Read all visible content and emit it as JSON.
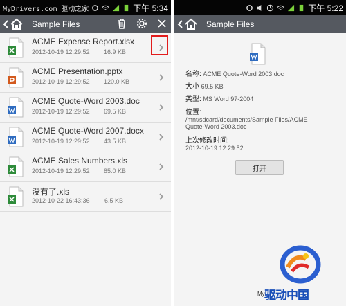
{
  "watermark_top": "MyDrivers.com 驱动之家",
  "left_status": {
    "time": "下午 5:34"
  },
  "right_status": {
    "time": "下午 5:22"
  },
  "left_appbar": {
    "title": "Sample Files"
  },
  "right_appbar": {
    "title": "Sample Files"
  },
  "files": [
    {
      "name": "ACME Expense Report.xlsx",
      "date": "2012-10-19 12:29:52",
      "size": "16.9 KB",
      "type": "xls"
    },
    {
      "name": "ACME Presentation.pptx",
      "date": "2012-10-19 12:29:52",
      "size": "120.0 KB",
      "type": "ppt"
    },
    {
      "name": "ACME Quote-Word 2003.doc",
      "date": "2012-10-19 12:29:52",
      "size": "69.5 KB",
      "type": "doc"
    },
    {
      "name": "ACME Quote-Word 2007.docx",
      "date": "2012-10-19 12:29:52",
      "size": "43.5 KB",
      "type": "doc"
    },
    {
      "name": "ACME Sales Numbers.xls",
      "date": "2012-10-19 12:29:52",
      "size": "85.0 KB",
      "type": "xls"
    },
    {
      "name": "没有了.xls",
      "date": "2012-10-22 16:43:36",
      "size": "6.5 KB",
      "type": "xls"
    }
  ],
  "detail": {
    "name_label": "名称:",
    "name_value": "ACME Quote-Word 2003.doc",
    "size_label": "大小",
    "size_value": "69.5 KB",
    "type_label": "类型:",
    "type_value": "MS Word 97-2004",
    "location_label": "位置:",
    "location_line1": "/mnt/sdcard/documents/Sample Files/ACME",
    "location_line2": "Quote-Word 2003.doc",
    "modified_label": "上次修改时间:",
    "modified_value": "2012-10-19 12:29:52",
    "open_button": "打开"
  },
  "watermark_bottom": {
    "brand": "驱动中国",
    "site": "My"
  },
  "colors": {
    "statusbar": "#050505",
    "appbar": "#555960",
    "background": "#f4f4f4",
    "highlight": "#e21c1c",
    "xls": "#2e8b3a",
    "ppt": "#d35a1e",
    "doc": "#2f6cc0"
  },
  "icons": [
    "home-icon",
    "back-chevron-icon",
    "trash-icon",
    "gear-icon",
    "close-icon",
    "chevron-right-icon",
    "wifi-icon",
    "signal-icon",
    "battery-icon",
    "sync-icon",
    "alarm-icon",
    "mute-icon"
  ]
}
